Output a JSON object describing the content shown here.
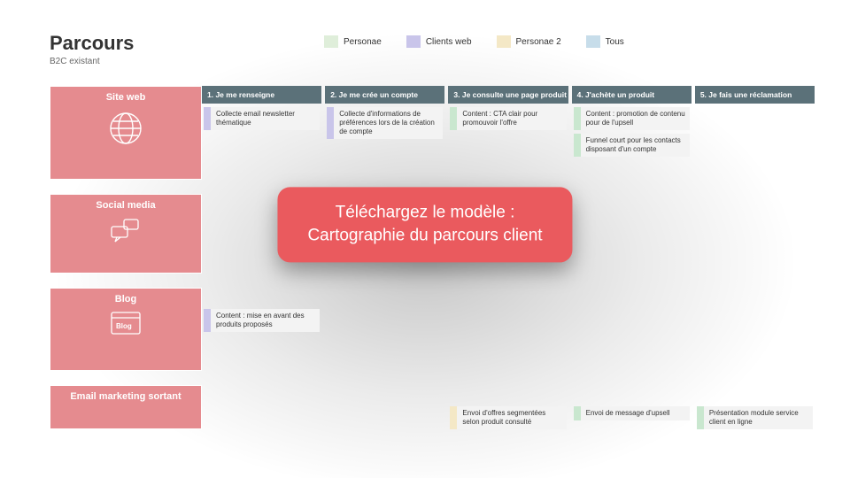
{
  "title": "Parcours",
  "subtitle": "B2C existant",
  "personas": [
    {
      "label": "Personae",
      "swatch": "#dfeeda"
    },
    {
      "label": "Clients web",
      "swatch": "#c9c5ea"
    },
    {
      "label": "Personae 2",
      "swatch": "#f4e8c6"
    },
    {
      "label": "Tous",
      "swatch": "#c7ddea"
    }
  ],
  "columns": [
    "1.   Je me renseigne",
    "2.   Je me crée un compte",
    "3.   Je consulte une page produit",
    "4.   J'achète un produit",
    "5.   Je fais une réclamation"
  ],
  "rows": [
    {
      "label": "Site web"
    },
    {
      "label": "Social media"
    },
    {
      "label": "Blog"
    },
    {
      "label": "Email marketing sortant"
    }
  ],
  "cells": {
    "r0c0": "Collecte email newsletter thématique",
    "r0c1": "Collecte d'informations de préférences lors de la création de compte",
    "r0c2": "Content : CTA clair pour promouvoir l'offre",
    "r0c3a": "Content : promotion de contenu pour de l'upsell",
    "r0c3b": "Funnel court pour les contacts disposant d'un compte",
    "r2c0": "Content : mise en avant des produits proposés",
    "r3c2": "Envoi d'offres segmentées selon produit consulté",
    "r3c3": "Envoi de message d'upsell",
    "r3c4": "Présentation module service client en ligne"
  },
  "cta": {
    "line1": "Téléchargez le modèle :",
    "line2": "Cartographie du parcours client"
  }
}
